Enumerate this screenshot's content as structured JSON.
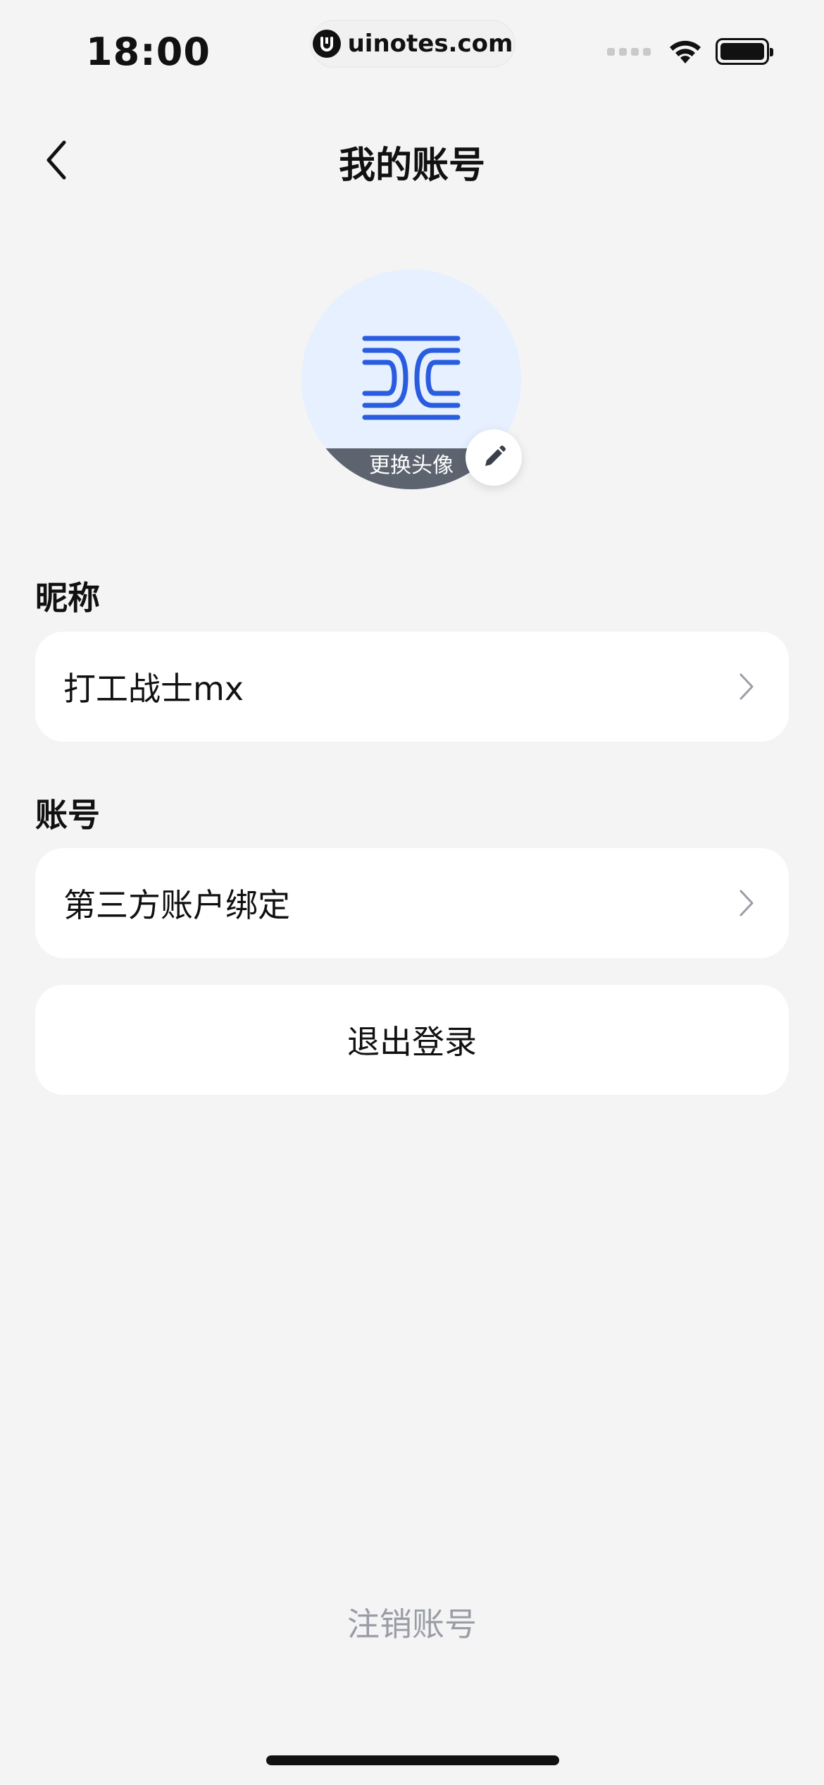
{
  "status_bar": {
    "time": "18:00",
    "url": "uinotes.com",
    "icons": [
      "cellular-signal-icon",
      "wifi-icon",
      "battery-icon"
    ]
  },
  "nav": {
    "back_icon": "chevron-left-icon",
    "title": "我的账号"
  },
  "avatar": {
    "change_label": "更换头像",
    "edit_icon": "pencil-icon",
    "accent_color": "#2a5ce0",
    "background_color": "#e6f0fe"
  },
  "nickname_section": {
    "label": "昵称",
    "value": "打工战士mx"
  },
  "account_section": {
    "label": "账号",
    "third_party_binding": "第三方账户绑定",
    "logout": "退出登录"
  },
  "deactivate_label": "注销账号"
}
